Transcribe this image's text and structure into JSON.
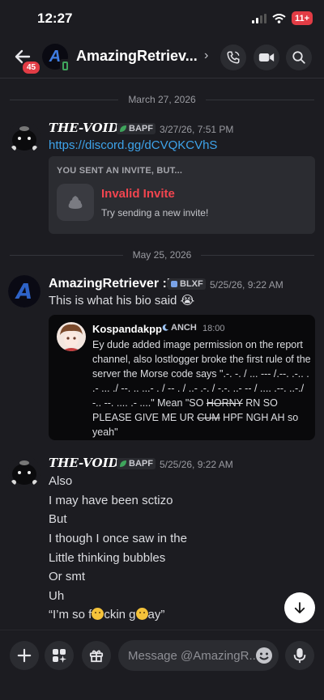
{
  "status": {
    "time": "12:27",
    "battery": "11+"
  },
  "header": {
    "back_badge": "45",
    "title": "AmazingRetriev...",
    "avatar_letter": "A"
  },
  "separators": {
    "first": "March 27, 2026",
    "second": "May 25, 2026"
  },
  "messages": [
    {
      "author": "THE-VOID",
      "tag": "BAPF",
      "timestamp": "3/27/26, 7:51 PM",
      "link": "https://discord.gg/dCVQKCVhS",
      "invite": {
        "header": "YOU SENT AN INVITE, BUT...",
        "title": "Invalid Invite",
        "subtitle": "Try sending a new invite!"
      }
    },
    {
      "author": "AmazingRetriever :D",
      "tag": "BLXF",
      "timestamp": "5/25/26, 9:22 AM",
      "text": "This is what his bio said 😭",
      "quote": {
        "author": "Kospandakpp",
        "tag": "ANCH",
        "time": "18:00",
        "body_1": "Ey dude added image permission on the report channel, also lostlogger broke the first rule of the server the Morse code says \".-. -. / ... --- /.--. .-.. . .- ... ./ --. .. ...- . / -- . / ..- .-. / -.-. ..- -- / .... .--. ..-./ -.. --. .... .- ....\" Mean \"SO ",
        "strike_1": "HORNY",
        "body_2": " RN SO PLEASE GIVE ME UR ",
        "strike_2": "CUM",
        "body_3": " HPF NGH AH so yeah\""
      }
    },
    {
      "author": "THE-VOID",
      "tag": "BAPF",
      "timestamp": "5/25/26, 9:22 AM",
      "lines": [
        "Also",
        "I may have been sctizo",
        "But",
        "I though I once saw in the",
        "Little thinking bubbles",
        "Or smt",
        "Uh"
      ],
      "last_line": {
        "part1": "“I’m so f",
        "part2": "ckin g",
        "part3": "ay”"
      }
    }
  ],
  "composer": {
    "placeholder": "Message @AmazingR..."
  }
}
